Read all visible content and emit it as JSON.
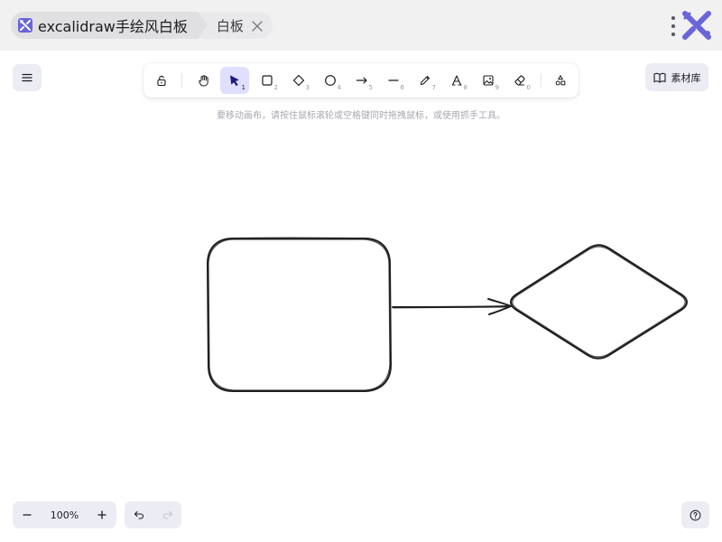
{
  "window": {
    "title": "excalidraw手绘风白板",
    "tab_label": "白板",
    "accent_color": "#6965db"
  },
  "toolbar": {
    "tools": [
      {
        "name": "lock",
        "icon": "lock-icon",
        "key": ""
      },
      {
        "name": "hand",
        "icon": "hand-icon",
        "key": ""
      },
      {
        "name": "selection",
        "icon": "pointer-icon",
        "key": "1",
        "active": true
      },
      {
        "name": "rectangle",
        "icon": "square-icon",
        "key": "2"
      },
      {
        "name": "diamond",
        "icon": "diamond-icon",
        "key": "3"
      },
      {
        "name": "ellipse",
        "icon": "circle-icon",
        "key": "4"
      },
      {
        "name": "arrow",
        "icon": "arrow-icon",
        "key": "5"
      },
      {
        "name": "line",
        "icon": "line-icon",
        "key": "6"
      },
      {
        "name": "draw",
        "icon": "pencil-icon",
        "key": "7"
      },
      {
        "name": "text",
        "icon": "text-icon",
        "key": "8"
      },
      {
        "name": "image",
        "icon": "image-icon",
        "key": "9"
      },
      {
        "name": "eraser",
        "icon": "eraser-icon",
        "key": "0"
      },
      {
        "name": "more-shapes",
        "icon": "shapes-icon",
        "key": ""
      }
    ],
    "active_color": "#e0dfff"
  },
  "library": {
    "label": "素材库"
  },
  "hint": "要移动画布，请按住鼠标滚轮或空格键同时拖拽鼠标，或使用抓手工具。",
  "zoom": {
    "level": "100%"
  },
  "canvas_elements": [
    {
      "type": "rectangle"
    },
    {
      "type": "arrow"
    },
    {
      "type": "diamond"
    }
  ]
}
